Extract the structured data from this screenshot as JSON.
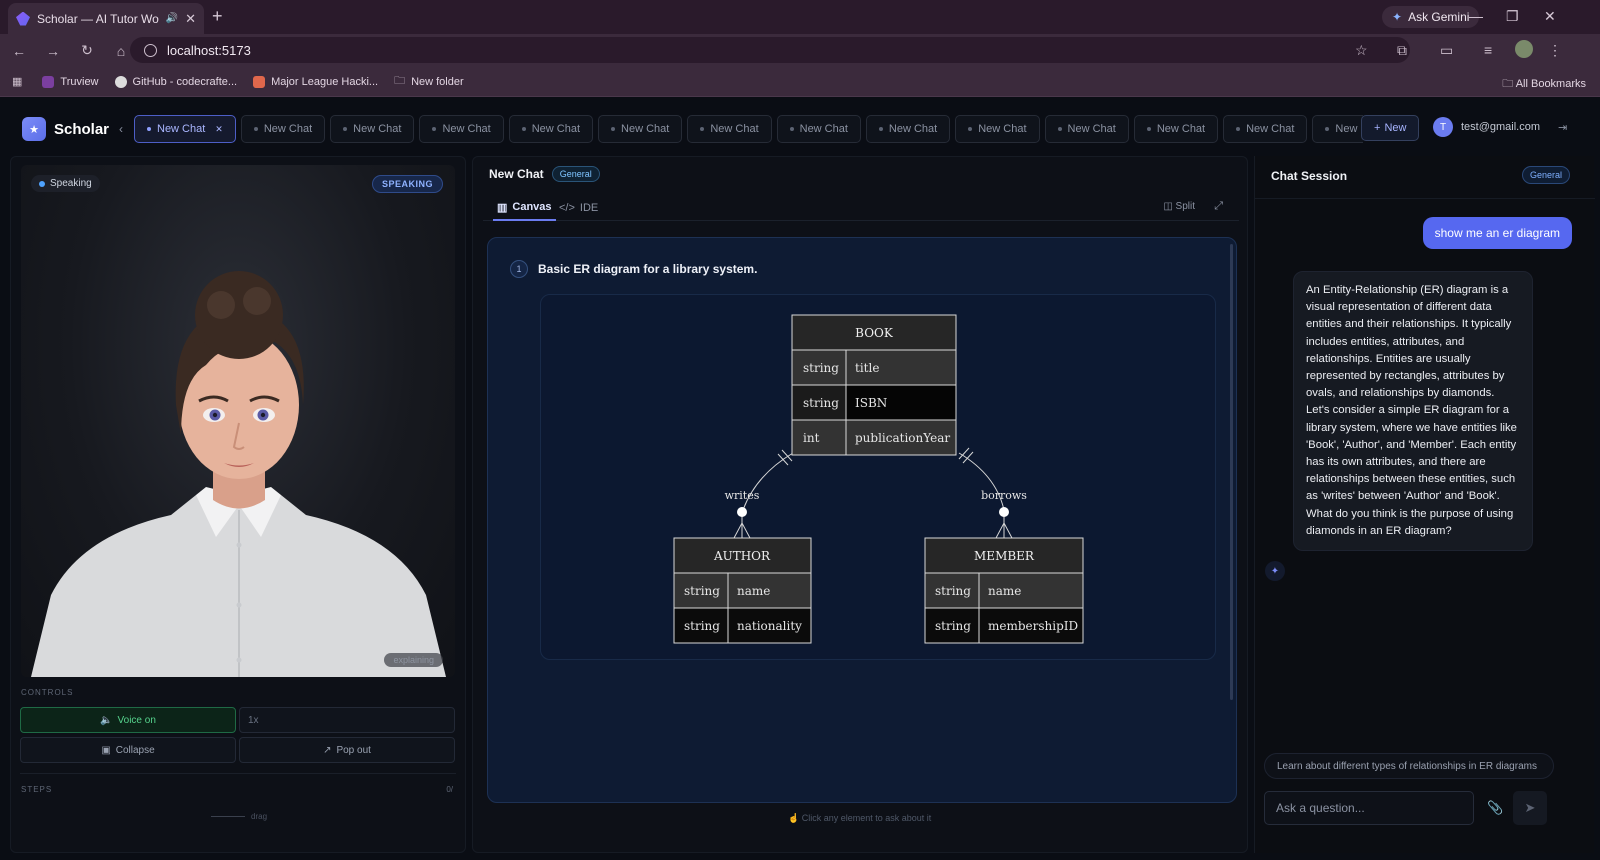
{
  "browser": {
    "tab_title": "Scholar — AI Tutor Worksp",
    "ask_gemini": "Ask Gemini",
    "url": "localhost:5173",
    "bookmarks": [
      "Truview",
      "GitHub - codecrafte...",
      "Major League Hacki...",
      "New folder"
    ],
    "all_bookmarks": "All Bookmarks"
  },
  "app": {
    "brand": "Scholar",
    "chat_tabs": [
      "New Chat",
      "New Chat",
      "New Chat",
      "New Chat",
      "New Chat",
      "New Chat",
      "New Chat",
      "New Chat",
      "New Chat",
      "New Chat",
      "New Chat",
      "New Chat",
      "New Chat",
      "New Chat",
      "N"
    ],
    "new_button": "New",
    "user_initial": "T",
    "user_email": "test@gmail.com"
  },
  "left": {
    "speaking_pill": "Speaking",
    "speaking_badge": "SPEAKING",
    "explaining": "explaining",
    "controls_label": "CONTROLS",
    "voice_btn": "Voice on",
    "speed_btn": "1x",
    "collapse_btn": "Collapse",
    "popout_btn": "Pop out",
    "steps_label": "STEPS",
    "steps_count": "0/",
    "drag_label": "drag"
  },
  "middle": {
    "title": "New Chat",
    "badge": "General",
    "tab_canvas": "Canvas",
    "tab_ide": "IDE",
    "split": "Split",
    "step_number": "1",
    "step_title": "Basic ER diagram for a library system.",
    "hint": "Click any element to ask about it"
  },
  "diagram": {
    "book": {
      "name": "BOOK",
      "rows": [
        [
          "string",
          "title"
        ],
        [
          "string",
          "ISBN"
        ],
        [
          "int",
          "publicationYear"
        ]
      ]
    },
    "author": {
      "name": "AUTHOR",
      "rows": [
        [
          "string",
          "name"
        ],
        [
          "string",
          "nationality"
        ]
      ]
    },
    "member": {
      "name": "MEMBER",
      "rows": [
        [
          "string",
          "name"
        ],
        [
          "string",
          "membershipID"
        ]
      ]
    },
    "rel_writes": "writes",
    "rel_borrows": "borrows"
  },
  "right": {
    "title": "Chat Session",
    "badge": "General",
    "user_message": "show me an er diagram",
    "bot_message": "An Entity-Relationship (ER) diagram is a visual representation of different data entities and their relationships. It typically includes entities, attributes, and relationships. Entities are usually represented by rectangles, attributes by ovals, and relationships by diamonds. Let's consider a simple ER diagram for a library system, where we have entities like 'Book', 'Author', and 'Member'. Each entity has its own attributes, and there are relationships between these entities, such as 'writes' between 'Author' and 'Book'. What do you think is the purpose of using diamonds in an ER diagram?",
    "suggestion": "Learn about different types of relationships in ER diagrams",
    "input_placeholder": "Ask a question..."
  }
}
